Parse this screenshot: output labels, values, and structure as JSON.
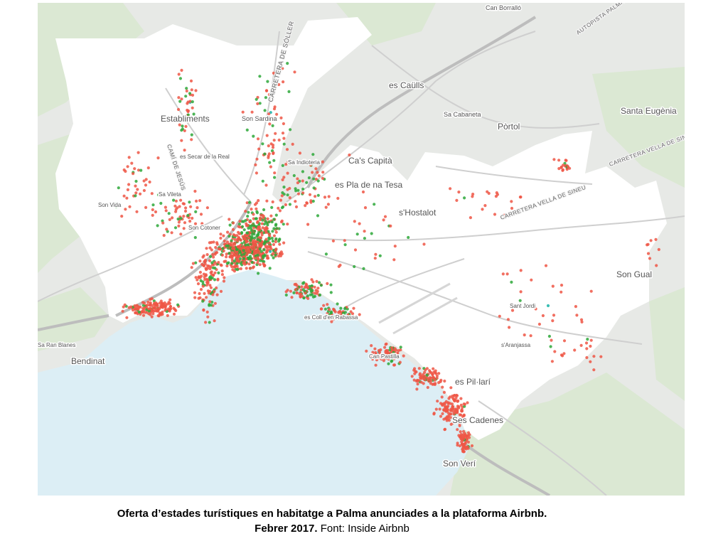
{
  "map": {
    "type": "dot-map",
    "colors": {
      "sea": "#dceef5",
      "land_outside": "#e7e9e6",
      "city_area": "#ffffff",
      "green_area": "#dbe8d3",
      "road": "#c9c9c9",
      "highway": "#bdbdbd",
      "dot_red": "#ef5645",
      "dot_green": "#2ea83a",
      "dot_teal": "#19b3a8"
    },
    "labels": {
      "can_borrallo": "Can Borralló",
      "autopista_palma": "AUTOPISTA PALMA",
      "carretera_soller": "CARRETERA DE SÓLLER",
      "es_caulls": "es Caülls",
      "establiments": "Establiments",
      "son_sardina": "Son Sardina",
      "sa_cabaneta": "Sa Cabaneta",
      "portol": "Pòrtol",
      "santa_eugenia": "Santa Eugènia",
      "carretera_vella_sineu_1": "CARRETERA VELLA DE SINEU",
      "cami_de_jesus": "CAMÍ DE JESÚS",
      "es_secar_real": "es Secar de la Real",
      "sa_indioteria": "Sa Indioteria",
      "cas_capita": "Ca's Capità",
      "es_pla_na_tesa": "es Pla de na Tesa",
      "sa_vileta": "Sa Vileta",
      "son_vida": "Son Vida",
      "shostalot": "s'Hostalot",
      "carretera_vella_sineu_2": "CARRETERA VELLA DE SINEU",
      "son_cotoner": "Son Cotoner",
      "son_gual": "Son Gual",
      "es_coll_rabassa": "es Coll d'en Rabassa",
      "sant_jordi": "Sant Jordi",
      "sa_ran_blanes": "Sa Ran Blanes",
      "bendinat": "Bendinat",
      "saranjassa": "s'Aranjassa",
      "es_pil_lari": "es Pil·larí",
      "sometimes_arenal": "",
      "ses_cadenes": "Ses Cadenes",
      "son_veri": "Son Verí",
      "can_pastilla": "Can Pastilla"
    }
  },
  "caption": {
    "line1": "Oferta d’estades turístiques en habitatge a Palma anunciades a la plataforma Airbnb.",
    "line2_bold": "Febrer 2017.",
    "line2_rest": " Font: Inside Airbnb"
  }
}
